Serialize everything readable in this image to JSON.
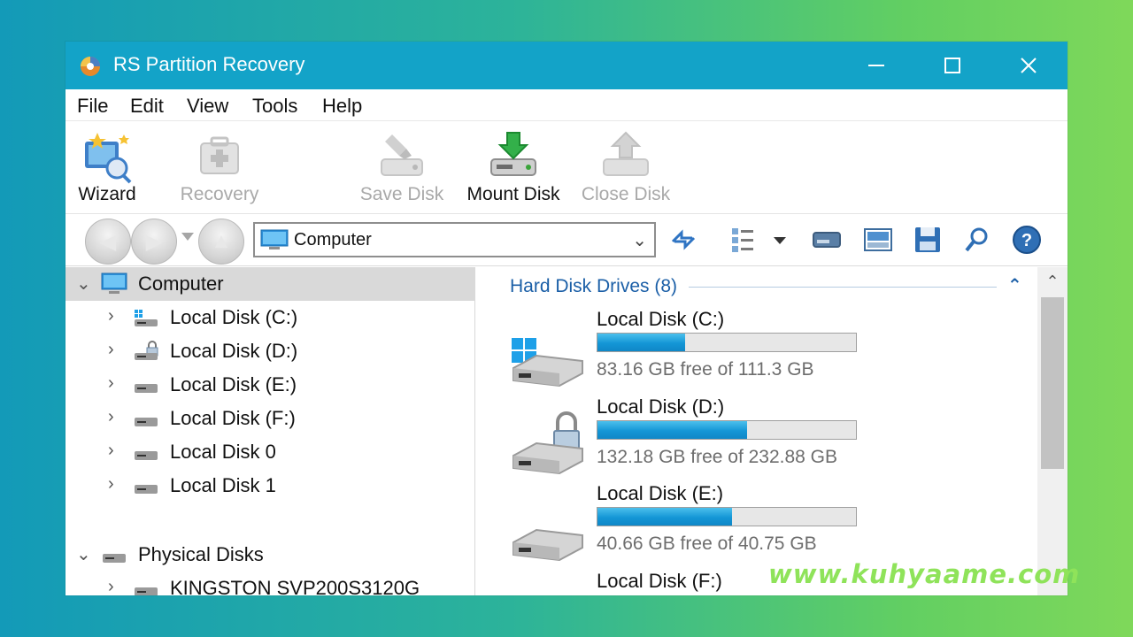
{
  "window": {
    "title": "RS Partition Recovery",
    "controls": {
      "minimize": "—",
      "maximize": "☐",
      "close": "✕"
    }
  },
  "menu": [
    {
      "label": "File"
    },
    {
      "label": "Edit"
    },
    {
      "label": "View"
    },
    {
      "label": "Tools"
    },
    {
      "label": "Help"
    }
  ],
  "toolbar": {
    "items": [
      {
        "label": "Wizard",
        "icon": "wizard-icon",
        "enabled": true
      },
      {
        "label": "Recovery",
        "icon": "recovery-icon",
        "enabled": false
      },
      {
        "label": "Save Disk",
        "icon": "save-disk-icon",
        "enabled": false
      },
      {
        "label": "Mount Disk",
        "icon": "mount-disk-icon",
        "enabled": true
      },
      {
        "label": "Close Disk",
        "icon": "close-disk-icon",
        "enabled": false
      }
    ]
  },
  "address": {
    "value": "Computer",
    "icons": [
      "refresh-icon",
      "view-options-icon",
      "drive-icon",
      "image-icon",
      "save-icon",
      "search-icon",
      "help-icon"
    ]
  },
  "tree": {
    "computer_label": "Computer",
    "computer_children": [
      {
        "label": "Local Disk (C:)",
        "icon": "windows-drive-icon"
      },
      {
        "label": "Local Disk (D:)",
        "icon": "locked-drive-icon"
      },
      {
        "label": "Local Disk (E:)",
        "icon": "drive-icon"
      },
      {
        "label": "Local Disk (F:)",
        "icon": "drive-icon"
      },
      {
        "label": "Local Disk 0",
        "icon": "drive-icon"
      },
      {
        "label": "Local Disk 1",
        "icon": "drive-icon"
      }
    ],
    "physical_label": "Physical Disks",
    "physical_children": [
      {
        "label": "KINGSTON SVP200S3120G",
        "icon": "drive-icon"
      }
    ]
  },
  "content": {
    "group_title": "Hard Disk Drives (8)",
    "disks": [
      {
        "name": "Local Disk (C:)",
        "free_text": "83.16 GB free of 111.3 GB",
        "used_fraction": 0.34,
        "icon": "windows-drive-icon"
      },
      {
        "name": "Local Disk (D:)",
        "free_text": "132.18 GB free of 232.88 GB",
        "used_fraction": 0.58,
        "icon": "locked-drive-icon"
      },
      {
        "name": "Local Disk (E:)",
        "free_text": "40.66 GB free of 40.75 GB",
        "used_fraction": 0.52,
        "icon": "drive-icon"
      },
      {
        "name": "Local Disk (F:)",
        "free_text": "",
        "used_fraction": 0,
        "icon": "drive-icon"
      }
    ]
  },
  "watermark": "www.kuhyaame.com",
  "colors": {
    "titlebar": "#13a3c8",
    "group_title": "#1b5fa7",
    "bar_fill": "#1496d6",
    "watermark": "#8fe35a"
  }
}
